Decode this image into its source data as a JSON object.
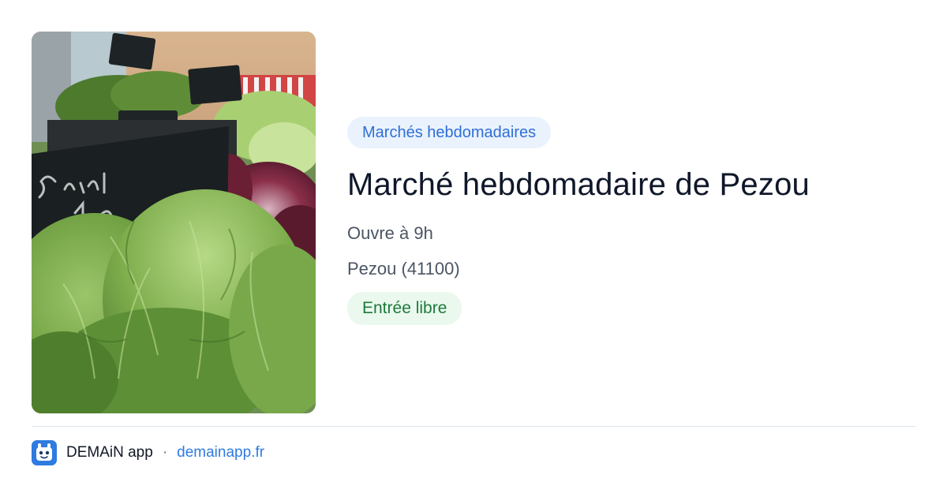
{
  "card": {
    "category": "Marchés hebdomadaires",
    "title": "Marché hebdomadaire de Pezou",
    "opening": "Ouvre à 9h",
    "location": "Pezou (41100)",
    "access": "Entrée libre"
  },
  "photo": {
    "icon": "market-lettuce-photo"
  },
  "footer": {
    "app_name": "DEMAiN app",
    "separator": "·",
    "site": "demainapp.fr",
    "icon": "demain-app-logo-icon"
  },
  "colors": {
    "category_pill_bg": "#eaf2fd",
    "category_pill_text": "#2f6fd6",
    "access_pill_bg": "#eaf8ee",
    "access_pill_text": "#1e7a3a",
    "link": "#2f7be0"
  }
}
